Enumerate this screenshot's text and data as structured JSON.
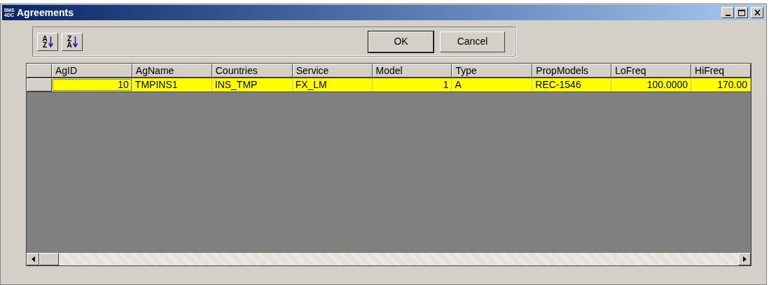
{
  "window": {
    "title": "Agreements",
    "logo": [
      "SMS",
      "4DC"
    ]
  },
  "toolbar": {
    "sort_buttons": [
      {
        "top": "A",
        "bottom": "Z"
      },
      {
        "top": "Z",
        "bottom": "A"
      }
    ],
    "buttons": [
      {
        "label": "OK",
        "kind": "default"
      },
      {
        "label": "Cancel",
        "kind": "normal"
      }
    ]
  },
  "grid": {
    "columns": [
      {
        "label": "AgID",
        "kind": "number"
      },
      {
        "label": "AgName",
        "kind": "text"
      },
      {
        "label": "Countries",
        "kind": "text"
      },
      {
        "label": "Service",
        "kind": "text"
      },
      {
        "label": "Model",
        "kind": "number"
      },
      {
        "label": "Type",
        "kind": "text"
      },
      {
        "label": "PropModels",
        "kind": "text"
      },
      {
        "label": "LoFreq",
        "kind": "number"
      },
      {
        "label": "HiFreq",
        "kind": "number"
      }
    ],
    "rows": [
      {
        "selected": true,
        "cells": [
          {
            "text": "10",
            "focused": true
          },
          {
            "text": "TMPINS1",
            "focused": false
          },
          {
            "text": "INS_TMP",
            "focused": false
          },
          {
            "text": "FX_LM",
            "focused": false
          },
          {
            "text": "1",
            "focused": false
          },
          {
            "text": "A",
            "focused": false
          },
          {
            "text": "REC-1546",
            "focused": false
          },
          {
            "text": "100.0000",
            "focused": false
          },
          {
            "text": "170.00",
            "focused": false
          }
        ]
      }
    ]
  }
}
